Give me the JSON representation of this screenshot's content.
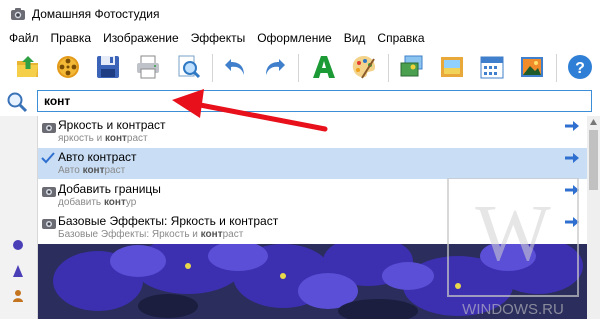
{
  "window": {
    "title": "Домашняя Фотостудия"
  },
  "menu": [
    "Файл",
    "Правка",
    "Изображение",
    "Эффекты",
    "Оформление",
    "Вид",
    "Справка"
  ],
  "toolbar": [
    {
      "name": "open-button-icon",
      "label": "open"
    },
    {
      "name": "library-button-icon",
      "label": "library"
    },
    {
      "name": "save-button-icon",
      "label": "save"
    },
    {
      "name": "print-button-icon",
      "label": "print"
    },
    {
      "name": "preview-button-icon",
      "label": "preview"
    },
    {
      "name": "undo-button-icon",
      "label": "undo"
    },
    {
      "name": "redo-button-icon",
      "label": "redo"
    },
    {
      "name": "text-button-icon",
      "label": "text"
    },
    {
      "name": "palette-button-icon",
      "label": "palette"
    },
    {
      "name": "collage-button-icon",
      "label": "collage"
    },
    {
      "name": "frame-button-icon",
      "label": "frame"
    },
    {
      "name": "calendar-button-icon",
      "label": "calendar"
    },
    {
      "name": "postcard-button-icon",
      "label": "postcard"
    },
    {
      "name": "help-button-icon",
      "label": "help"
    }
  ],
  "search": {
    "value": "конт"
  },
  "suggestions": [
    {
      "title": "Яркость и контраст",
      "sub_pre": "яркость и ",
      "sub_bold": "конт",
      "sub_post": "раст",
      "selected": false
    },
    {
      "title": "Авто контраст",
      "sub_pre": "Авто ",
      "sub_bold": "конт",
      "sub_post": "раст",
      "selected": true
    },
    {
      "title": "Добавить границы",
      "sub_pre": "добавить ",
      "sub_bold": "конт",
      "sub_post": "ур",
      "selected": false
    },
    {
      "title": "Базовые Эффекты: Яркость и контраст",
      "sub_pre": "Базовые Эффекты: Яркость и ",
      "sub_bold": "конт",
      "sub_post": "раст",
      "selected": false
    }
  ],
  "watermark": {
    "letter": "W",
    "text": "WINDOWS.RU"
  },
  "colors": {
    "accent": "#3c8fd6",
    "selected_row": "#c9def5",
    "arrow": "#e8101a"
  }
}
